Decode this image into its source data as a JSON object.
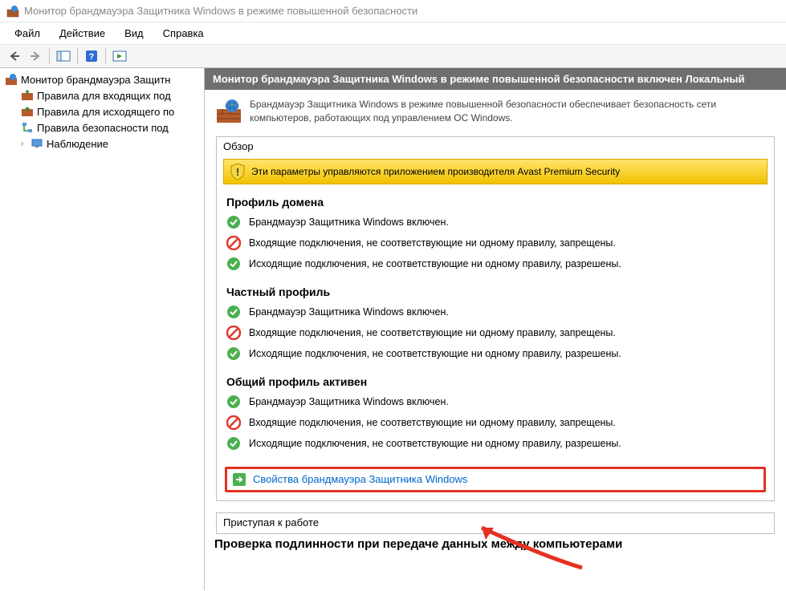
{
  "window": {
    "title": "Монитор брандмауэра Защитника Windows в режиме повышенной безопасности"
  },
  "menu": {
    "file": "Файл",
    "action": "Действие",
    "view": "Вид",
    "help": "Справка"
  },
  "tree": {
    "root": "Монитор брандмауэра Защитн",
    "inbound": "Правила для входящих под",
    "outbound": "Правила для исходящего по",
    "consec": "Правила безопасности под",
    "monitor": "Наблюдение"
  },
  "panel": {
    "header": "Монитор брандмауэра Защитника Windows в режиме повышенной безопасности включен Локальный",
    "intro": "Брандмауэр Защитника Windows в режиме повышенной безопасности обеспечивает безопасность сети компьютеров, работающих под управлением ОС Windows."
  },
  "overview": {
    "title": "Обзор",
    "warn": "Эти параметры управляются приложением производителя Avast Premium Security",
    "profiles": [
      {
        "title": "Профиль домена",
        "rows": [
          {
            "icon": "ok",
            "text": "Брандмауэр Защитника Windows включен."
          },
          {
            "icon": "no",
            "text": "Входящие подключения, не соответствующие ни одному правилу, запрещены."
          },
          {
            "icon": "ok",
            "text": "Исходящие подключения, не соответствующие ни одному правилу, разрешены."
          }
        ]
      },
      {
        "title": "Частный профиль",
        "rows": [
          {
            "icon": "ok",
            "text": "Брандмауэр Защитника Windows включен."
          },
          {
            "icon": "no",
            "text": "Входящие подключения, не соответствующие ни одному правилу, запрещены."
          },
          {
            "icon": "ok",
            "text": "Исходящие подключения, не соответствующие ни одному правилу, разрешены."
          }
        ]
      },
      {
        "title": "Общий профиль активен",
        "rows": [
          {
            "icon": "ok",
            "text": "Брандмауэр Защитника Windows включен."
          },
          {
            "icon": "no",
            "text": "Входящие подключения, не соответствующие ни одному правилу, запрещены."
          },
          {
            "icon": "ok",
            "text": "Исходящие подключения, не соответствующие ни одному правилу, разрешены."
          }
        ]
      }
    ],
    "link": "Свойства брандмауэра Защитника Windows"
  },
  "getting_started": {
    "title": "Приступая к работе",
    "heading": "Проверка подлинности при передаче данных между компьютерами"
  }
}
